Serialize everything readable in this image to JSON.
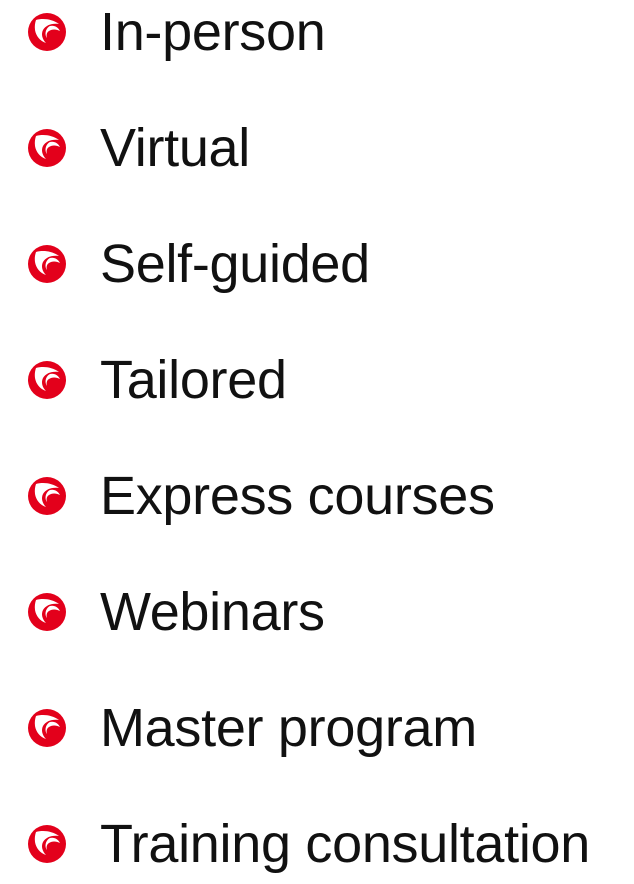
{
  "bullet_icon": "red-circle-swirl-icon",
  "bullet_color": "#e3001b",
  "text_color": "#111111",
  "items": [
    {
      "label": "In-person"
    },
    {
      "label": "Virtual"
    },
    {
      "label": "Self-guided"
    },
    {
      "label": "Tailored"
    },
    {
      "label": "Express courses"
    },
    {
      "label": "Webinars"
    },
    {
      "label": "Master program"
    },
    {
      "label": "Training consultation"
    }
  ]
}
